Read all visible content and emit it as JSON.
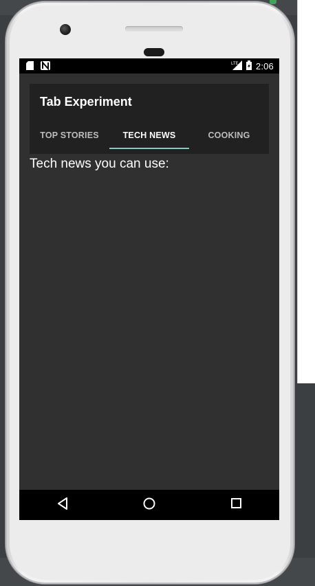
{
  "status_bar": {
    "time": "2:06",
    "icons": [
      "sd-card-icon",
      "notification-n-icon",
      "lte-signal-icon",
      "battery-charging-icon"
    ]
  },
  "app": {
    "title": "Tab Experiment",
    "tabs": [
      {
        "label": "TOP STORIES",
        "active": false
      },
      {
        "label": "TECH NEWS",
        "active": true
      },
      {
        "label": "COOKING",
        "active": false
      }
    ],
    "content_text": "Tech news you can use:"
  },
  "nav_bar": {
    "buttons": [
      "back-icon",
      "home-icon",
      "recents-icon"
    ]
  },
  "colors": {
    "accent": "#80cbc4",
    "toolbar": "#212121",
    "background": "#303030"
  }
}
